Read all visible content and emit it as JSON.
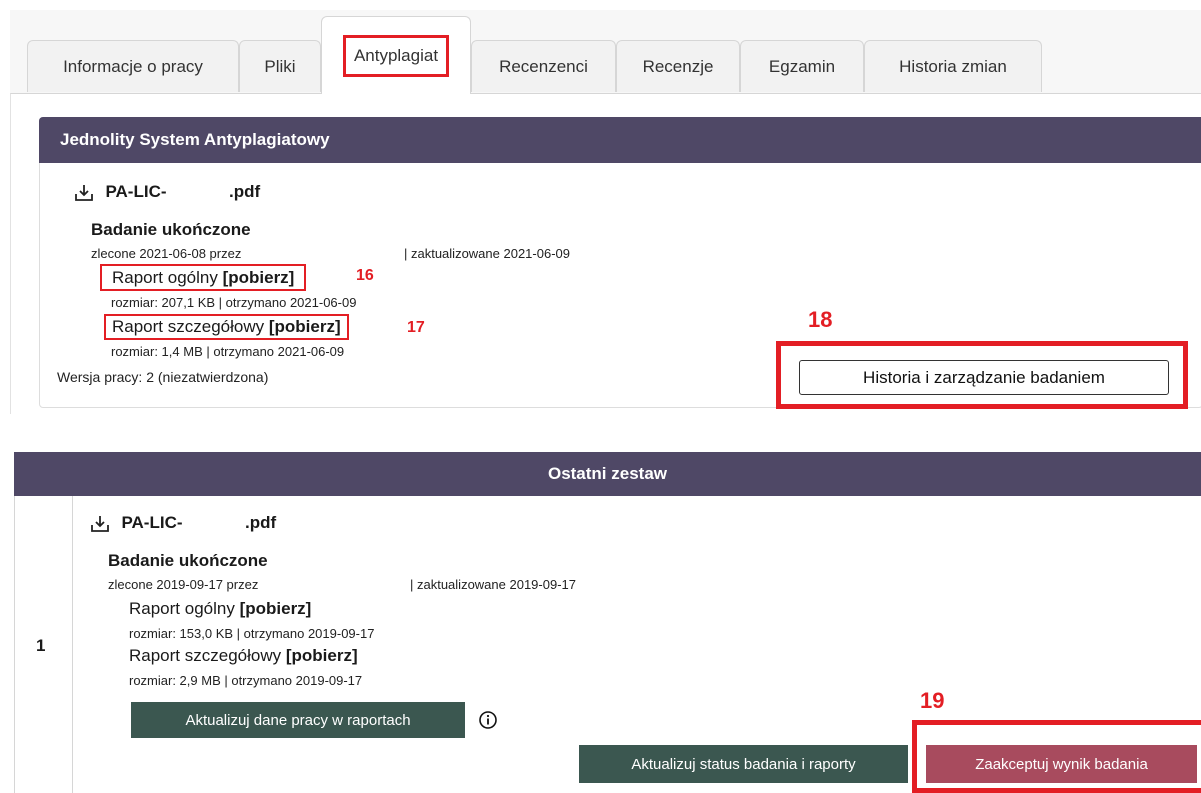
{
  "tabs": [
    {
      "label": "Informacje o pracy"
    },
    {
      "label": "Pliki"
    },
    {
      "label": "Antyplagiat"
    },
    {
      "label": "Recenzenci"
    },
    {
      "label": "Recenzje"
    },
    {
      "label": "Egzamin"
    },
    {
      "label": "Historia zmian"
    }
  ],
  "jsa": {
    "title": "Jednolity System Antyplagiatowy",
    "file_prefix": "PA-LIC-",
    "file_suffix": ".pdf",
    "status": "Badanie ukończone",
    "ordered": "zlecone 2021-06-08 przez",
    "updated": "| zaktualizowane 2021-06-09",
    "report_general": {
      "label": "Raport ogólny",
      "link": "[pobierz]",
      "meta": "rozmiar: 207,1 KB | otrzymano 2021-06-09",
      "marker": "16"
    },
    "report_detail": {
      "label": "Raport szczegółowy",
      "link": "[pobierz]",
      "meta": "rozmiar: 1,4 MB | otrzymano 2021-06-09",
      "marker": "17"
    },
    "version": "Wersja pracy: 2 (niezatwierdzona)",
    "history_button": "Historia i zarządzanie badaniem",
    "history_marker": "18"
  },
  "last_set": {
    "title": "Ostatni zestaw",
    "row_number": "1",
    "file_prefix": "PA-LIC-",
    "file_suffix": ".pdf",
    "status": "Badanie ukończone",
    "ordered": "zlecone 2019-09-17 przez",
    "updated": "| zaktualizowane 2019-09-17",
    "report_general": {
      "label": "Raport ogólny",
      "link": "[pobierz]",
      "meta": "rozmiar: 153,0 KB | otrzymano 2019-09-17"
    },
    "report_detail": {
      "label": "Raport szczegółowy",
      "link": "[pobierz]",
      "meta": "rozmiar: 2,9 MB | otrzymano 2019-09-17"
    },
    "update_data_button": "Aktualizuj dane pracy w raportach",
    "update_status_button": "Aktualizuj status badania i raporty",
    "accept_button": "Zaakceptuj wynik badania",
    "accept_marker": "19"
  },
  "colors": {
    "header": "#4f4866",
    "dark_button": "#3b5750",
    "accept_button": "#a84b5e",
    "highlight": "#e31e24"
  }
}
